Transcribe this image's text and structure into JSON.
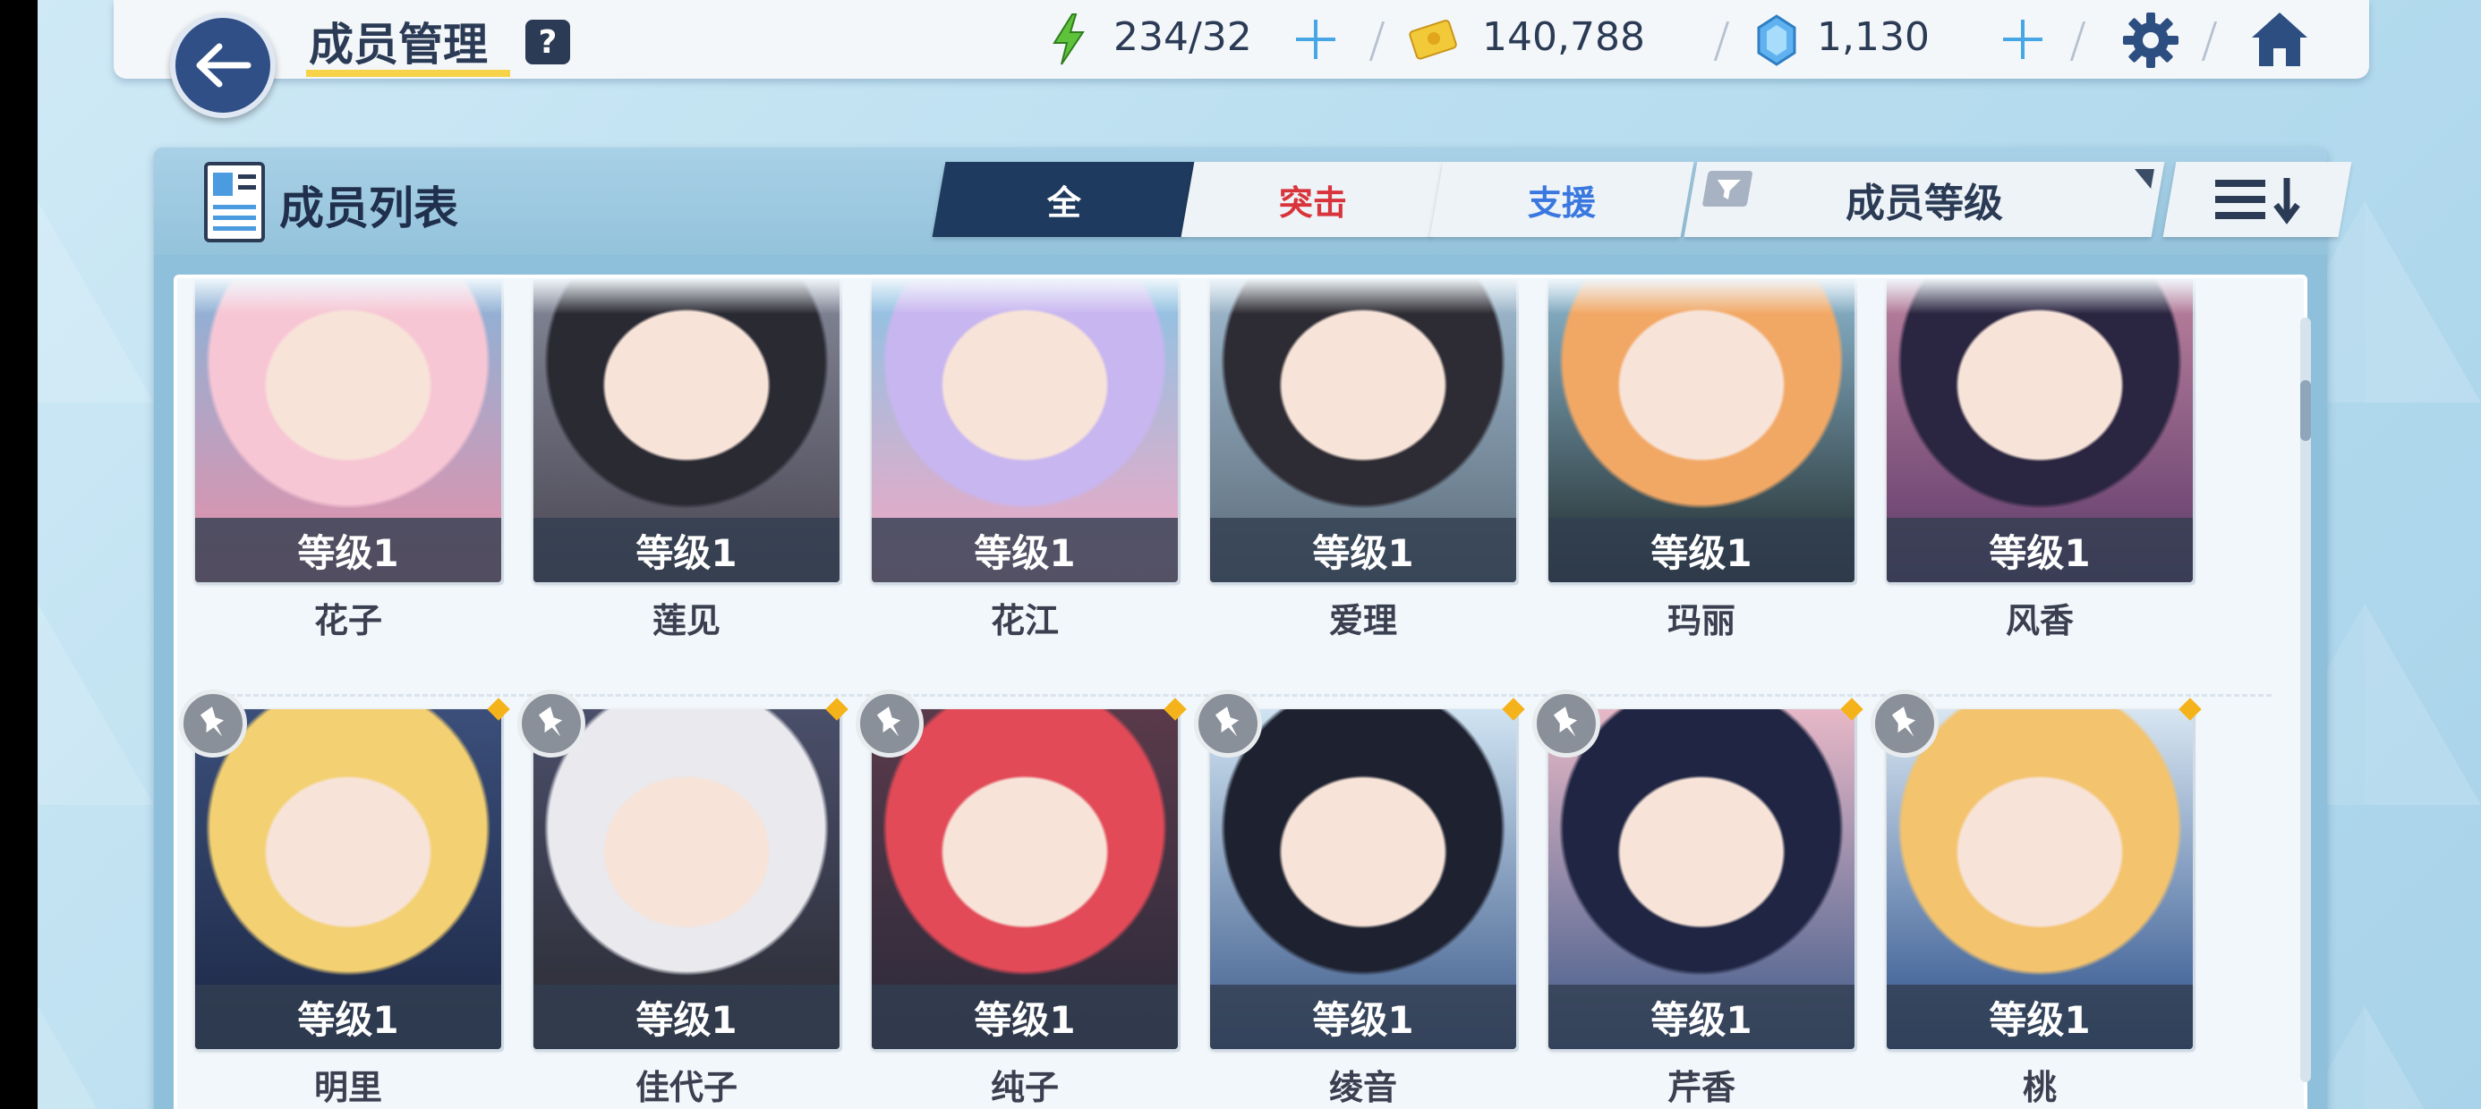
{
  "header": {
    "title": "成员管理",
    "help_label": "?",
    "ap": "234/32",
    "credits": "140,788",
    "gems": "1,130"
  },
  "panel": {
    "title": "成员列表",
    "tabs": [
      {
        "label": "全"
      },
      {
        "label": "突击"
      },
      {
        "label": "支援"
      }
    ],
    "sort_label": "成员等级"
  },
  "students": [
    {
      "name": "花子",
      "level": "等级1",
      "pinned": false
    },
    {
      "name": "莲见",
      "level": "等级1",
      "pinned": false
    },
    {
      "name": "花江",
      "level": "等级1",
      "pinned": false
    },
    {
      "name": "爱理",
      "level": "等级1",
      "pinned": false
    },
    {
      "name": "玛丽",
      "level": "等级1",
      "pinned": false
    },
    {
      "name": "风香",
      "level": "等级1",
      "pinned": false
    },
    {
      "name": "明里",
      "level": "等级1",
      "pinned": true
    },
    {
      "name": "佳代子",
      "level": "等级1",
      "pinned": true
    },
    {
      "name": "纯子",
      "level": "等级1",
      "pinned": true
    },
    {
      "name": "绫音",
      "level": "等级1",
      "pinned": true
    },
    {
      "name": "芹香",
      "level": "等级1",
      "pinned": true
    },
    {
      "name": "桃",
      "level": "等级1",
      "pinned": true
    }
  ],
  "colors": {
    "accent_dark": "#1e3a5e",
    "striker": "#d9333b",
    "special": "#3a78e0",
    "highlight": "#f7d34a",
    "new_dot": "#f5b31b"
  },
  "icons": [
    "back-arrow-icon",
    "ap-bolt-icon",
    "credit-icon",
    "gem-icon",
    "plus-icon",
    "gear-icon",
    "home-icon",
    "roster-icon",
    "filter-icon",
    "sort-order-icon",
    "pin-icon"
  ]
}
